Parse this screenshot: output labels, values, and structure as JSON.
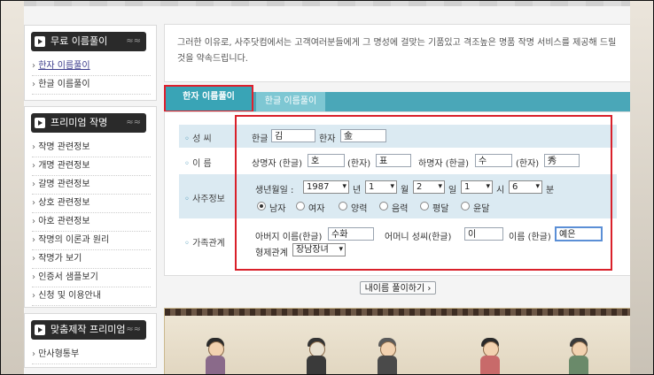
{
  "sidebar": {
    "box1": {
      "title": "무료 이름풀이",
      "ornament": "≈≈",
      "items": [
        {
          "label": "한자 이름풀이",
          "active": true
        },
        {
          "label": "한글 이름풀이",
          "active": false
        }
      ]
    },
    "box2": {
      "title": "프리미엄 작명",
      "ornament": "≈≈",
      "items": [
        {
          "label": "작명 관련정보"
        },
        {
          "label": "개명 관련정보"
        },
        {
          "label": "갈명 관련정보"
        },
        {
          "label": "상호 관련정보"
        },
        {
          "label": "아호 관련정보"
        },
        {
          "label": "작명의 이론과 원리"
        },
        {
          "label": "작명가 보기"
        },
        {
          "label": "인증서 샘플보기"
        },
        {
          "label": "신청 및 이용안내"
        }
      ]
    },
    "box3": {
      "title": "맞춤제작 프리미엄",
      "ornament": "≈≈",
      "items": [
        {
          "label": "만사형통부"
        }
      ]
    }
  },
  "intro": {
    "text": "그러한 이유로, 사주닷컴에서는 고객여러분들에게 그 명성에 걸맞는 기품있고 격조높은 명품 작명 서비스를 제공해 드릴것을 약속드립니다."
  },
  "tabs": {
    "hanja": "한자 이름풀이",
    "hangul": "한글 이름풀이"
  },
  "form": {
    "surname": {
      "label": "성 씨",
      "hangul_label": "한글",
      "hangul_value": "김",
      "hanja_label": "한자",
      "hanja_value": "金"
    },
    "given": {
      "label": "이 름",
      "first_label": "상명자 (한글)",
      "first_value": "호",
      "first_hanja_label": "(한자)",
      "first_hanja_value": "표",
      "second_label": "하명자 (한글)",
      "second_value": "수",
      "second_hanja_label": "(한자)",
      "second_hanja_value": "秀"
    },
    "saju": {
      "label": "사주정보",
      "birth_label": "생년월일 :",
      "year": "1987",
      "year_unit": "년",
      "month": "1",
      "month_unit": "월",
      "day": "2",
      "day_unit": "일",
      "hour": "1",
      "hour_unit": "시",
      "minute": "6",
      "minute_unit": "분",
      "gender": {
        "male": "남자",
        "female": "여자",
        "selected": "male"
      },
      "calendar": {
        "solar": "양력",
        "lunar": "음력",
        "normal": "평달",
        "leap": "윤달"
      }
    },
    "family": {
      "label": "가족관계",
      "father_label": "아버지 이름(한글)",
      "father_value": "수화",
      "mother_surname_label": "어머니 성씨(한글)",
      "mother_surname_value": "이",
      "mother_name_label": "이름 (한글)",
      "mother_name_value": "예은",
      "sibling_label": "형제관계",
      "sibling_value": "장남장녀"
    }
  },
  "submit_label": "내이름 풀이하기 ›"
}
